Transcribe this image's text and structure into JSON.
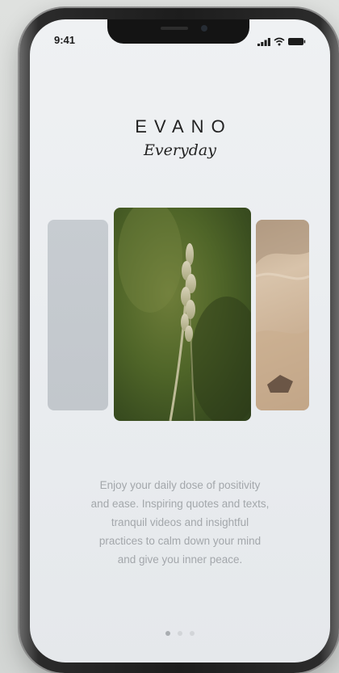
{
  "status_bar": {
    "time": "9:41"
  },
  "brand": {
    "name": "EVANO",
    "tagline": "Everyday"
  },
  "carousel": {
    "cards": [
      {
        "name": "blank-card",
        "color": "#c5cacf"
      },
      {
        "name": "grass-photo",
        "color": "#4f6528"
      },
      {
        "name": "sand-photo",
        "color": "#cdb396"
      }
    ]
  },
  "description": {
    "lines": [
      "Enjoy your daily dose of positivity",
      "and ease. Inspiring quotes and texts,",
      "tranquil videos and insightful",
      "practices to calm down your mind",
      "and give you inner peace."
    ]
  },
  "pagination": {
    "total": 3,
    "active_index": 0
  },
  "icons": {
    "signal": "signal-icon",
    "wifi": "wifi-icon",
    "battery": "battery-icon"
  }
}
